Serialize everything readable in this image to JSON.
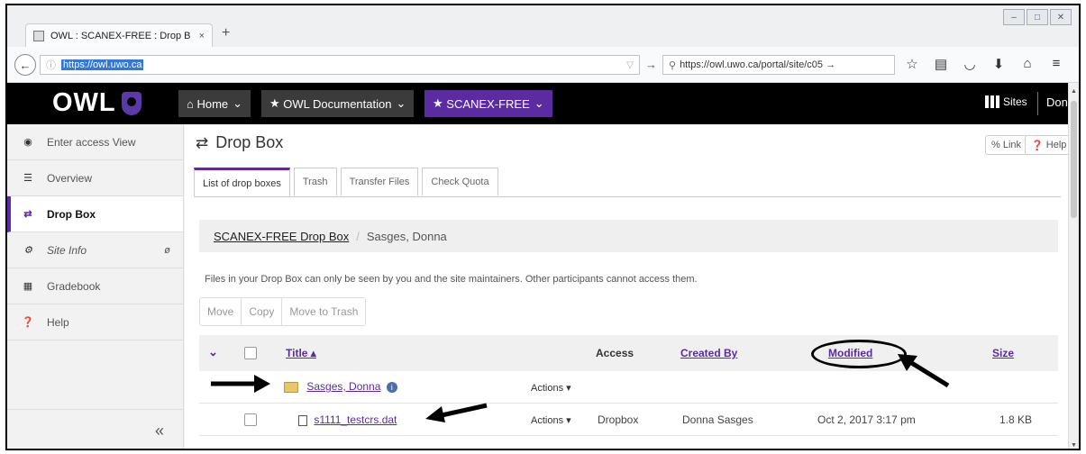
{
  "browser": {
    "tab_title": "OWL : SCANEX-FREE : Drop B",
    "tab_close": "×",
    "new_tab": "+",
    "url_selected": "https://owl.uwo.ca",
    "search_text": "https://owl.uwo.ca/portal/site/c05 →",
    "window_controls": [
      "–",
      "□",
      "✕"
    ]
  },
  "owl_header": {
    "logo": "OWL",
    "nav": [
      {
        "icon": "home-icon",
        "label": "Home",
        "chevron": "⌄"
      },
      {
        "icon": "star-icon",
        "label": "OWL Documentation",
        "chevron": "⌄"
      },
      {
        "icon": "star-icon",
        "label": "SCANEX-FREE",
        "chevron": "⌄"
      }
    ],
    "sites_label": "Sites",
    "user_label": "Donna ▾"
  },
  "sidebar": {
    "items": [
      {
        "label": "Enter access View",
        "icon": "eye-icon"
      },
      {
        "label": "Overview",
        "icon": "list-icon"
      },
      {
        "label": "Drop Box",
        "icon": "swap-icon"
      },
      {
        "label": "Site Info",
        "icon": "gear-icon"
      },
      {
        "label": "Gradebook",
        "icon": "table-icon"
      },
      {
        "label": "Help",
        "icon": "help-icon"
      }
    ],
    "collapse_label": "«"
  },
  "page": {
    "title": "Drop Box",
    "link_btn": "Link",
    "help_btn": "Help",
    "tabs": [
      "List of drop boxes",
      "Trash",
      "Transfer Files",
      "Check Quota"
    ],
    "breadcrumb_link": "SCANEX-FREE Drop Box",
    "breadcrumb_sep": "/",
    "breadcrumb_current": "Sasges, Donna",
    "info_message": "Files in your Drop Box can only be seen by you and the site maintainers. Other participants cannot access them.",
    "actions": [
      "Move",
      "Copy",
      "Move to Trash"
    ]
  },
  "table": {
    "headers": {
      "title": "Title ▴",
      "access": "Access",
      "created_by": "Created By",
      "modified": "Modified",
      "size": "Size"
    },
    "rows": [
      {
        "title": "Sasges, Donna",
        "actions": "Actions ▾",
        "access": "",
        "created_by": "",
        "modified": "",
        "size": ""
      },
      {
        "title": "s1111_testcrs.dat",
        "actions": "Actions ▾",
        "access": "Dropbox",
        "created_by": "Donna Sasges",
        "modified": "Oct 2, 2017 3:17 pm",
        "size": "1.8 KB"
      }
    ]
  }
}
